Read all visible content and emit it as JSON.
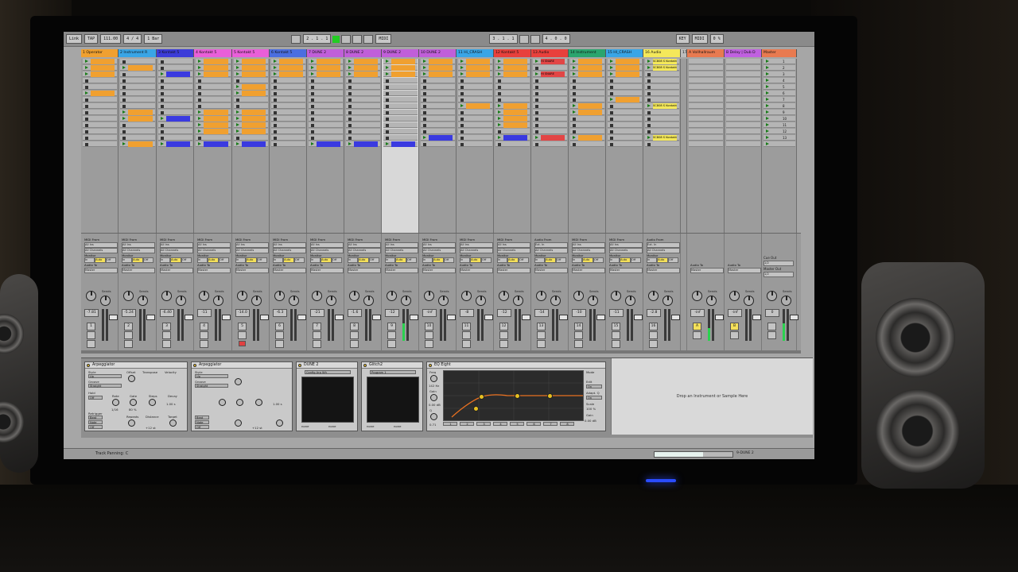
{
  "transport": {
    "link": "Link",
    "tap": "TAP",
    "tempo": "111.00",
    "signature": "4 / 4",
    "quantize": "1 Bar",
    "position": "2 . 1 . 1",
    "loop_start": "3 . 1 . 1",
    "loop_length": "4 . 0 . 0",
    "key_label": "KEY",
    "midi_label": "MIDI",
    "cpu": "0 %"
  },
  "tracks": [
    {
      "name": "1 Operator",
      "color": "#f0a030"
    },
    {
      "name": "2 Instrument R",
      "color": "#39a5e6"
    },
    {
      "name": "3 Kontakt 5",
      "color": "#3c3cd8"
    },
    {
      "name": "4 Kontakt 5",
      "color": "#e95fd9"
    },
    {
      "name": "5 Kontakt 5",
      "color": "#e95fd9"
    },
    {
      "name": "6 Kontakt 5",
      "color": "#4b6ee0"
    },
    {
      "name": "7 DUNE 2",
      "color": "#c05fd9"
    },
    {
      "name": "8 DUNE 2",
      "color": "#c05fd9"
    },
    {
      "name": "9 DUNE 2",
      "color": "#c05fd9"
    },
    {
      "name": "10 DUNE 2",
      "color": "#c05fd9"
    },
    {
      "name": "11 Hi_CRASH",
      "color": "#39a5e6"
    },
    {
      "name": "12 Kontakt 5",
      "color": "#e8403c"
    },
    {
      "name": "13 Audio",
      "color": "#e8403c"
    },
    {
      "name": "14 Instrument",
      "color": "#2aa56e"
    },
    {
      "name": "15 HI_CRASH",
      "color": "#39a5e6"
    },
    {
      "name": "16 Audio",
      "color": "#f4e85a"
    },
    {
      "name": "17",
      "color": "#bdbdbd"
    },
    {
      "name": "A Vollhallraum",
      "color": "#e87a50"
    },
    {
      "name": "B Delay | Dub D",
      "color": "#c060e0"
    },
    {
      "name": "Master",
      "color": "#e87a50"
    }
  ],
  "clip_names": {
    "hi_snare": "Hi SNARE",
    "hi_snare_2": "Hi SNARE",
    "scene_1": "SC808 S Kontakt",
    "scene_2": "SC808 S Kontakt",
    "scene_3": "SC808 S Kontakt",
    "scene_4": "SC808 S Kontakt",
    "scene_5": "SC808 S Kontakt"
  },
  "scene_numbers": [
    "1",
    "2",
    "3",
    "4",
    "5",
    "6",
    "7",
    "8",
    "9",
    "10",
    "11",
    "12",
    "13"
  ],
  "mixer": {
    "midi_from": "MIDI From",
    "audio_from": "Audio From",
    "all_ins": "All Ins",
    "all_channels": "All Channels",
    "monitor": "Monitor",
    "in": "In",
    "auto": "Auto",
    "off": "Off",
    "audio_to": "Audio To",
    "master": "Master",
    "sends": "Sends",
    "cue_out": "Cue Out",
    "master_out": "Master Out",
    "cue_val": "1/2",
    "master_val": "1/2",
    "post": "Post",
    "ext_in": "Ext. In",
    "vol_values": [
      "-7.81",
      "-5.24",
      "-6.40",
      "-11",
      "-14.0",
      "-6.3",
      "-21",
      "-1.6",
      "-12",
      "-inf",
      "-8",
      "-12",
      "-14",
      "-10",
      "-11",
      "-2.8",
      "-0.3",
      "-inf",
      "-inf",
      "0"
    ],
    "track_numbers": [
      "1",
      "2",
      "3",
      "4",
      "5",
      "6",
      "7",
      "8",
      "9",
      "10",
      "11",
      "12",
      "13",
      "14",
      "15",
      "16",
      "17",
      "A",
      "B",
      ""
    ],
    "meter_levels": [
      0,
      0,
      0,
      0,
      0,
      0,
      0,
      0,
      0.55,
      0,
      0,
      0,
      0,
      0,
      0,
      0,
      0,
      0.4,
      0,
      0.55
    ]
  },
  "devices": {
    "arp1": {
      "title": "Arpeggiator",
      "style_label": "Style",
      "style_val": "Up",
      "groove_label": "Groove",
      "groove_val": "Straight",
      "hold_label": "Hold",
      "offset_label": "Offset",
      "transpose_label": "Transpose",
      "velocity_label": "Velocity",
      "rate_label": "Rate",
      "gate_label": "Gate",
      "steps_label": "Steps",
      "decay_label": "Decay",
      "retrigger_label": "Retrigger",
      "repeats_label": "Repeats",
      "distance_label": "Distance",
      "target_label": "Target",
      "rate_val": "1/16",
      "gate_val": "80 %",
      "steps_val": "0",
      "decay_val": "1.00 s",
      "repeats_val": "inf",
      "distance_val": "+12 st",
      "off": "Off",
      "beat": "Beat",
      "note": "Note",
      "sync": "Sync"
    },
    "arp2": {
      "title": "Arpeggiator"
    },
    "dune": {
      "title": "DUNE 2",
      "preset": "Config Arp Wh",
      "none": "none",
      "none2": "none"
    },
    "glitch": {
      "title": "Glitch2",
      "preset": "Program 1",
      "none": "none",
      "none2": "none"
    },
    "eq": {
      "title": "EQ Eight",
      "freq_label": "Freq",
      "freq_val": "142 Hz",
      "gain_label": "Gain",
      "gain_val": "0.00 dB",
      "q_label": "Q",
      "q_val": "0.71",
      "mode_label": "Mode",
      "edit_label": "Edit",
      "adapt_label": "Adapt. Q",
      "scale_label": "Scale",
      "scale_val": "100 %",
      "gain_out_label": "Gain",
      "gain_out_val": "0.00 dB",
      "on": "On",
      "band_numbers": [
        "1",
        "2",
        "3",
        "4",
        "5",
        "6",
        "7",
        "8"
      ]
    },
    "drop_zone": "Drop an Instrument or Sample Here"
  },
  "statusbar": {
    "text": "Track Panning: C",
    "current_track": "9-DUNE 2"
  },
  "colors": {
    "clip_orange": "#f0a030",
    "clip_blue": "#3a3ae0",
    "clip_red": "#e24545",
    "play_green": "#1a7d1a",
    "meter_green": "#2bd24f"
  }
}
